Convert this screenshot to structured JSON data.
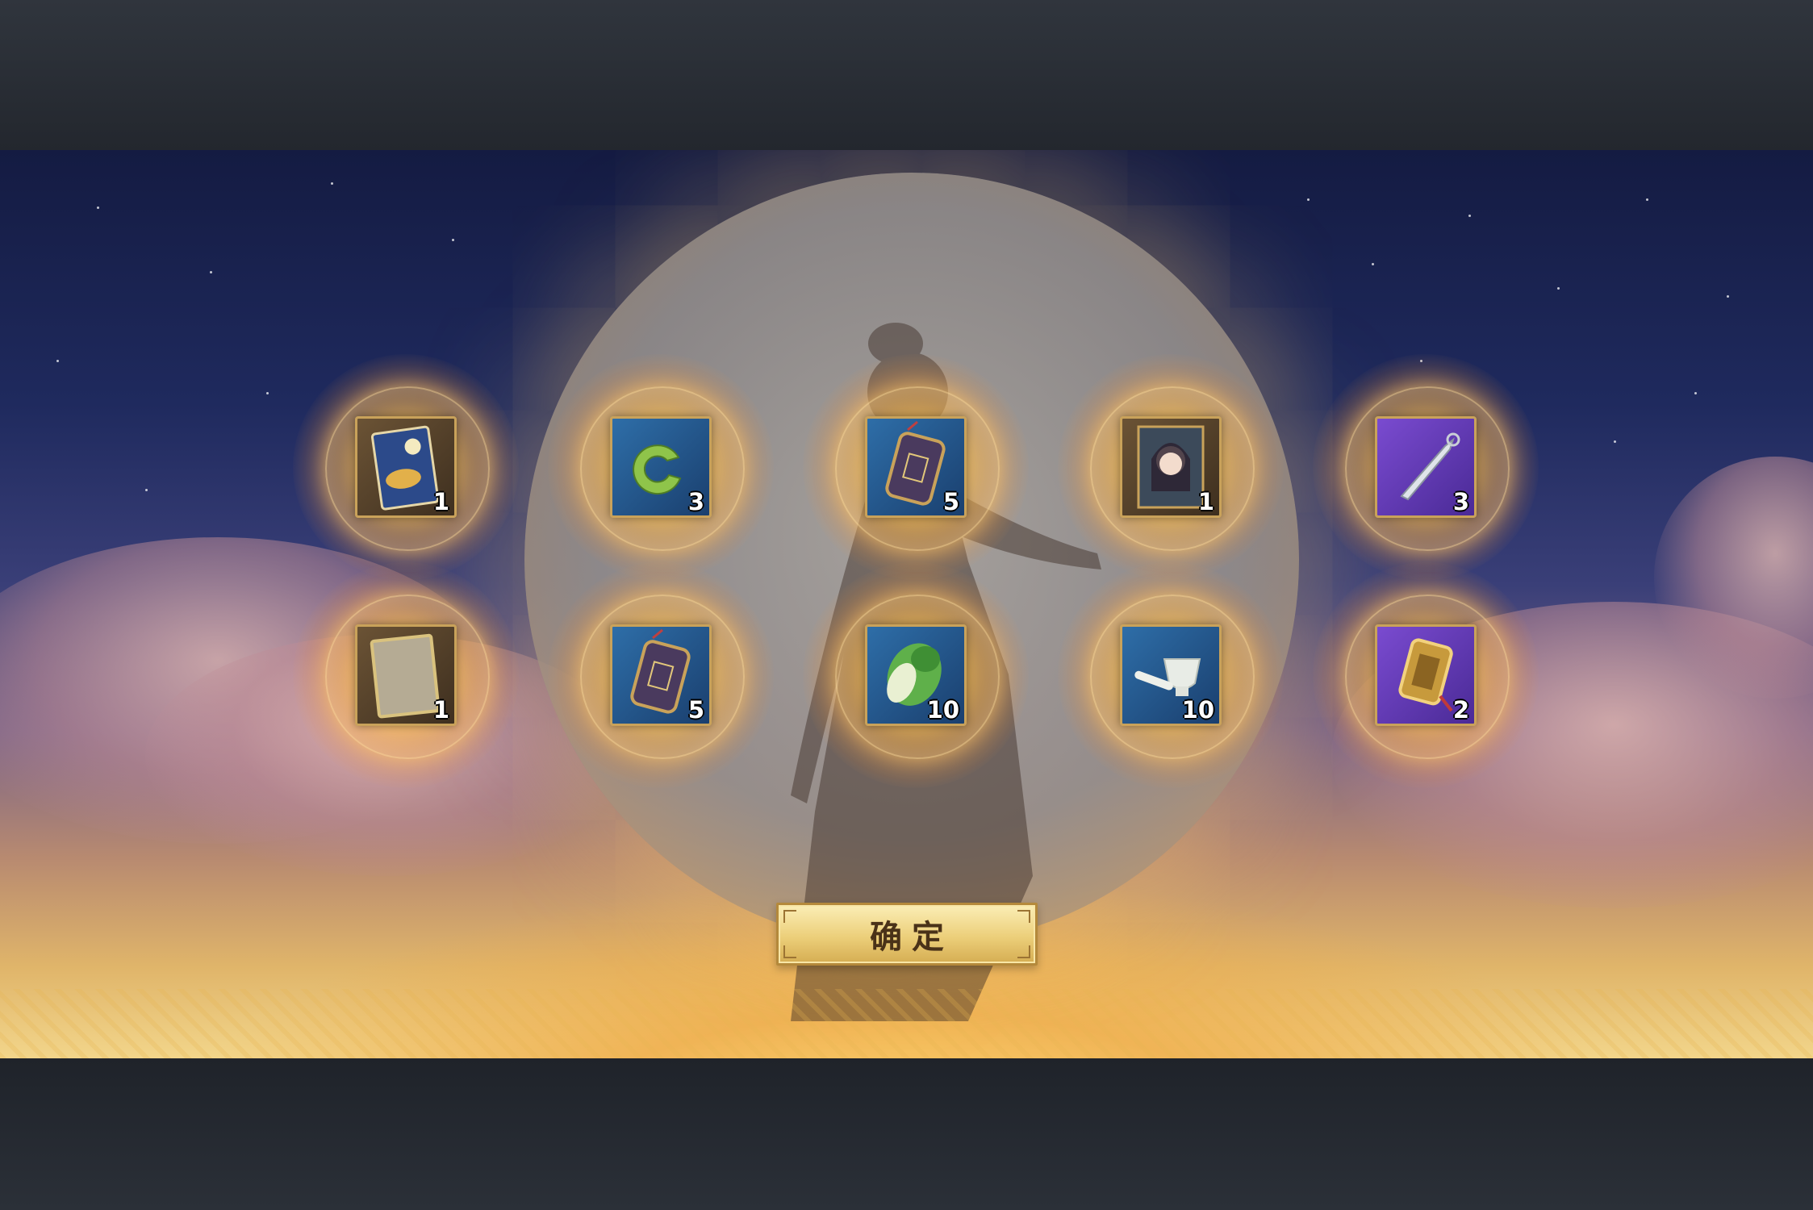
{
  "confirm_button": {
    "label": "确定"
  },
  "colors": {
    "frame_gold": "#c9a25a",
    "rarity_gold": "#6b5335",
    "rarity_blue": "#2e6ea8",
    "rarity_purple": "#7a4bd0",
    "button_text": "#4a3218"
  },
  "rewards": [
    {
      "icon": "moon-card-icon",
      "rarity": "gold",
      "quantity": "1"
    },
    {
      "icon": "jade-ring-icon",
      "rarity": "blue",
      "quantity": "3"
    },
    {
      "icon": "token-plaque-icon",
      "rarity": "blue",
      "quantity": "5"
    },
    {
      "icon": "portrait-card-icon",
      "rarity": "gold",
      "quantity": "1"
    },
    {
      "icon": "dagger-icon",
      "rarity": "purple",
      "quantity": "3"
    },
    {
      "icon": "blank-card-icon",
      "rarity": "gold",
      "quantity": "1"
    },
    {
      "icon": "token-plaque-icon",
      "rarity": "blue",
      "quantity": "5"
    },
    {
      "icon": "cabbage-icon",
      "rarity": "blue",
      "quantity": "10"
    },
    {
      "icon": "mortar-pestle-icon",
      "rarity": "blue",
      "quantity": "10"
    },
    {
      "icon": "gold-medallion-icon",
      "rarity": "purple",
      "quantity": "2"
    }
  ]
}
